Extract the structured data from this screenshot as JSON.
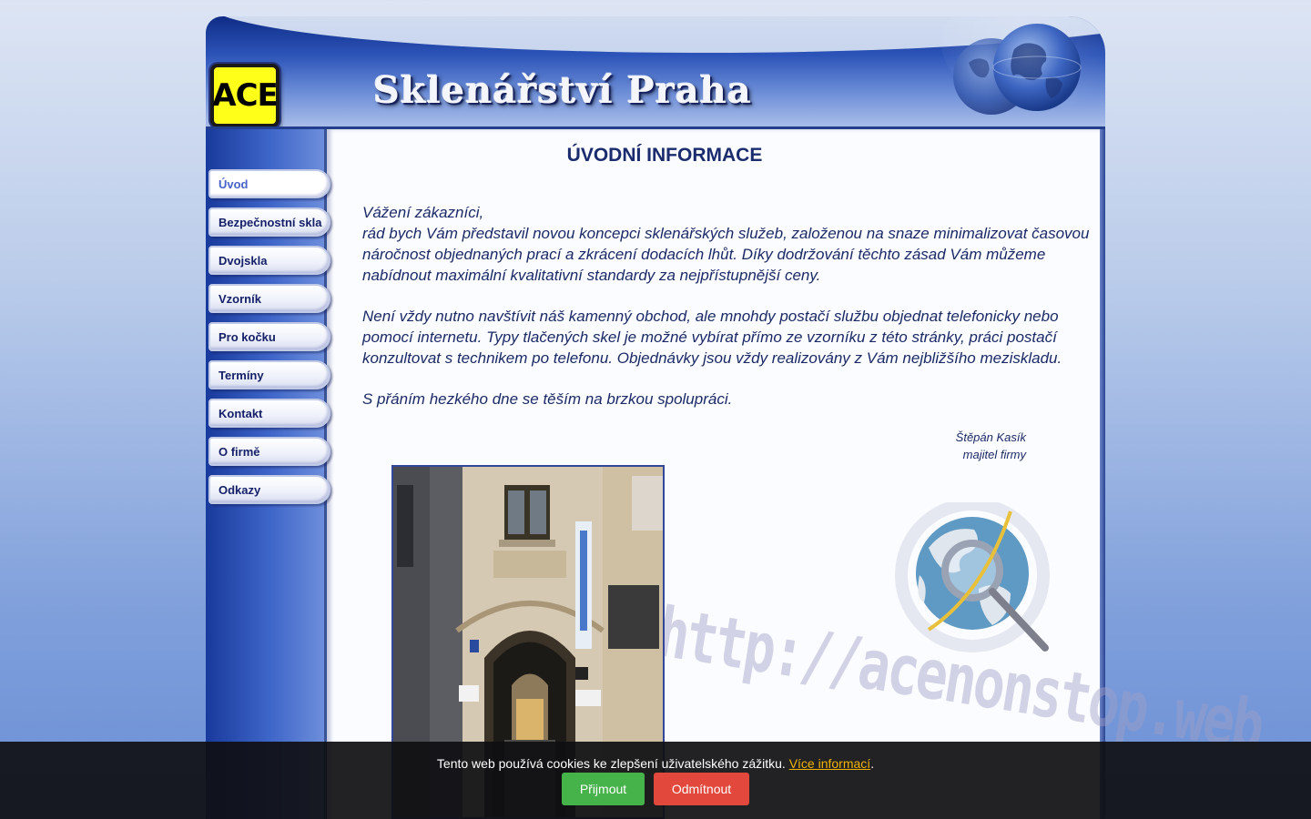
{
  "header": {
    "logo_text": "ACE",
    "site_title": "Sklenářství Praha"
  },
  "nav": {
    "items": [
      {
        "label": "Úvod",
        "active": true
      },
      {
        "label": "Bezpečnostní skla"
      },
      {
        "label": "Dvojskla"
      },
      {
        "label": "Vzorník"
      },
      {
        "label": "Pro kočku"
      },
      {
        "label": "Termíny"
      },
      {
        "label": "Kontakt"
      },
      {
        "label": "O firmě"
      },
      {
        "label": "Odkazy"
      }
    ]
  },
  "main": {
    "title": "ÚVODNÍ INFORMACE",
    "greeting": "Vážení zákazníci,",
    "paragraph1": "rád bych Vám představil novou koncepci sklenářských služeb, založenou na snaze minimalizovat časovou náročnost objednaných prací a zkrácení dodacích lhůt. Díky dodržování těchto zásad Vám můžeme nabídnout maximální kvalitativní standardy za nejpřístupnější ceny.",
    "paragraph2": "Není vždy nutno navštívit náš kamenný obchod, ale mnohdy postačí službu objednat telefonicky nebo pomocí internetu. Typy tlačených skel je možné vybírat přímo ze vzorníku z této stránky, práci postačí konzultovat s technikem po telefonu. Objednávky jsou vždy realizovány z Vám nejbližšího meziskladu.",
    "paragraph3": "S přáním hezkého dne se těším na brzkou spolupráci.",
    "signature_name": "Štěpán Kasík",
    "signature_role": "majitel firmy",
    "watermark": "http://acenonstop.web"
  },
  "cookie": {
    "text": "Tento web používá cookies ke zlepšení uživatelského zážitku.",
    "link": "Více informací",
    "link_suffix": ".",
    "accept": "Přijmout",
    "reject": "Odmítnout"
  },
  "colors": {
    "nav_text": "#152068",
    "nav_active": "#4a62c9",
    "accept": "#45b34a",
    "reject": "#e2483b",
    "link": "#f0b400"
  }
}
